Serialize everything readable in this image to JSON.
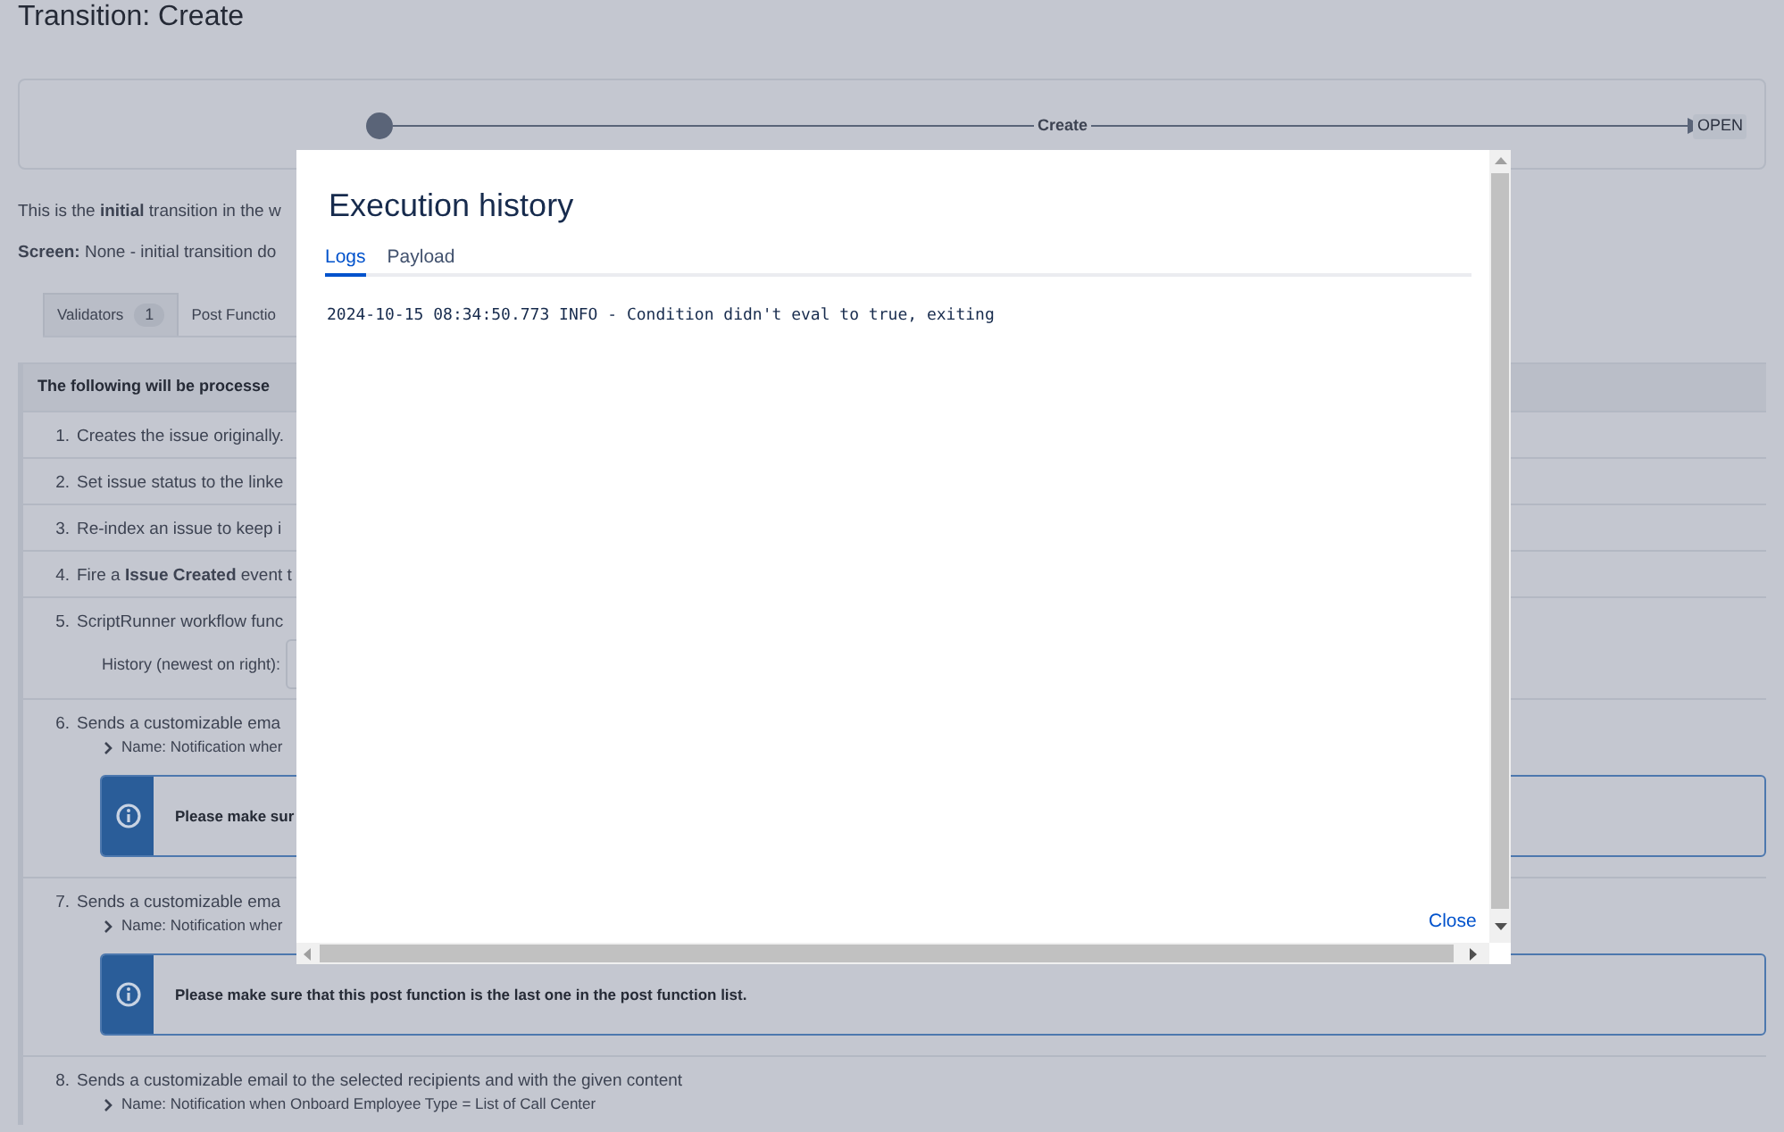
{
  "page_title": "Transition: Create",
  "diagram": {
    "transition_label": "Create",
    "target_status": "OPEN"
  },
  "description": "This is the **initial** transition in the w",
  "screen_line": "**Screen:** None - initial transition do",
  "tabs": [
    {
      "label": "Validators",
      "count": "1",
      "selected": true
    },
    {
      "label": "Post Functio",
      "selected": false
    }
  ],
  "panel": {
    "header": "The following will be processe",
    "steps": [
      {
        "number": "1.",
        "kind": "plain",
        "text": "Creates the issue originally."
      },
      {
        "number": "2.",
        "kind": "plain",
        "text": "Set issue status to the linke"
      },
      {
        "number": "3.",
        "kind": "plain",
        "text": "Re-index an issue to keep i"
      },
      {
        "number": "4.",
        "kind": "plain",
        "text": "Fire a **Issue Created** event t"
      },
      {
        "number": "5.",
        "kind": "history",
        "text": "ScriptRunner workflow func",
        "history_label": "History (newest on right):"
      },
      {
        "number": "6.",
        "kind": "email",
        "text": "Sends a customizable ema",
        "name": "Name: Notification wher",
        "info": "Please make sur"
      },
      {
        "number": "7.",
        "kind": "email",
        "text": "Sends a customizable ema",
        "name": "Name: Notification wher",
        "info": "Please make sure that this post function is the last one in the post function list."
      },
      {
        "number": "8.",
        "kind": "email",
        "text": "Sends a customizable email to the selected recipients and with the given content",
        "name": "Name: Notification when Onboard Employee Type = List of Call Center"
      }
    ]
  },
  "modal": {
    "title": "Execution history",
    "tabs": [
      {
        "label": "Logs",
        "selected": true
      },
      {
        "label": "Payload",
        "selected": false
      }
    ],
    "log_lines": [
      "2024-10-15 08:34:50.773 INFO - Condition didn't eval to true, exiting"
    ],
    "close": "Close"
  }
}
